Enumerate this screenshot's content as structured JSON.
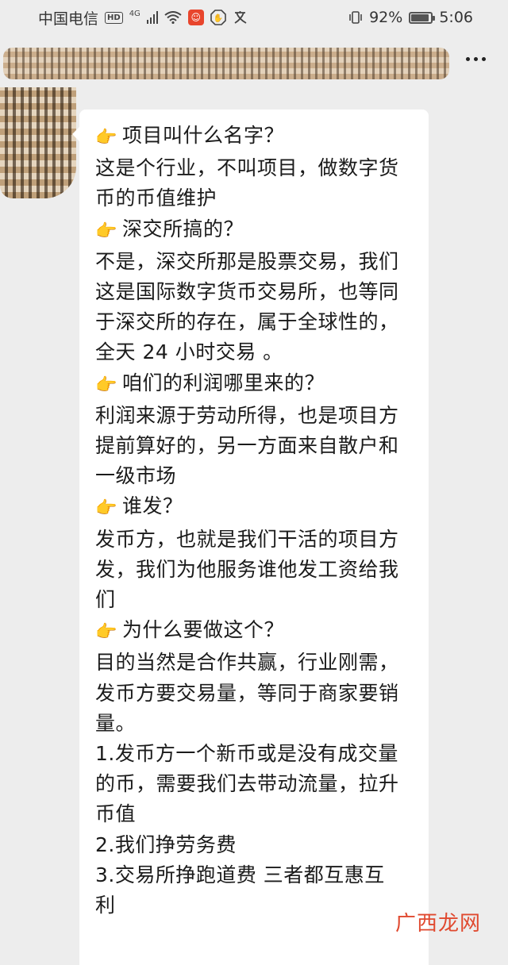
{
  "status_bar": {
    "carrier": "中国电信",
    "hd": "HD",
    "network": "4G",
    "battery_percent": "92%",
    "battery_level": 0.92,
    "time": "5:06"
  },
  "chat": {
    "lines": [
      {
        "icon": "pointing-hand",
        "text": "项目叫什么名字？"
      },
      {
        "text": "这是个行业，不叫项目，做数字货"
      },
      {
        "text": "币的币值维护"
      },
      {
        "icon": "pointing-hand",
        "text": "深交所搞的？"
      },
      {
        "text": "不是，深交所那是股票交易，我们"
      },
      {
        "text": "这是国际数字货币交易所，也等同"
      },
      {
        "text": "于深交所的存在，属于全球性的，"
      },
      {
        "text": "全天 24 小时交易 。"
      },
      {
        "icon": "pointing-hand",
        "text": "咱们的利润哪里来的？"
      },
      {
        "text": "利润来源于劳动所得，也是项目方"
      },
      {
        "text": "提前算好的，另一方面来自散户和"
      },
      {
        "text": "一级市场"
      },
      {
        "icon": "pointing-hand",
        "text": "谁发？"
      },
      {
        "text": "发币方，也就是我们干活的项目方"
      },
      {
        "text": "发，我们为他服务谁他发工资给我"
      },
      {
        "text": "们"
      },
      {
        "icon": "pointing-hand",
        "text": "为什么要做这个？"
      },
      {
        "text": "目的当然是合作共赢，行业刚需，"
      },
      {
        "text": "发币方要交易量，等同于商家要销"
      },
      {
        "text": "量。"
      },
      {
        "text": "1.发币方一个新币或是没有成交量"
      },
      {
        "text": "的币，需要我们去带动流量，拉升"
      },
      {
        "text": "币值"
      },
      {
        "text": "2.我们挣劳务费"
      },
      {
        "text": "3.交易所挣跑道费   三者都互惠互"
      },
      {
        "text": "利"
      }
    ]
  },
  "watermark": "广西龙网"
}
